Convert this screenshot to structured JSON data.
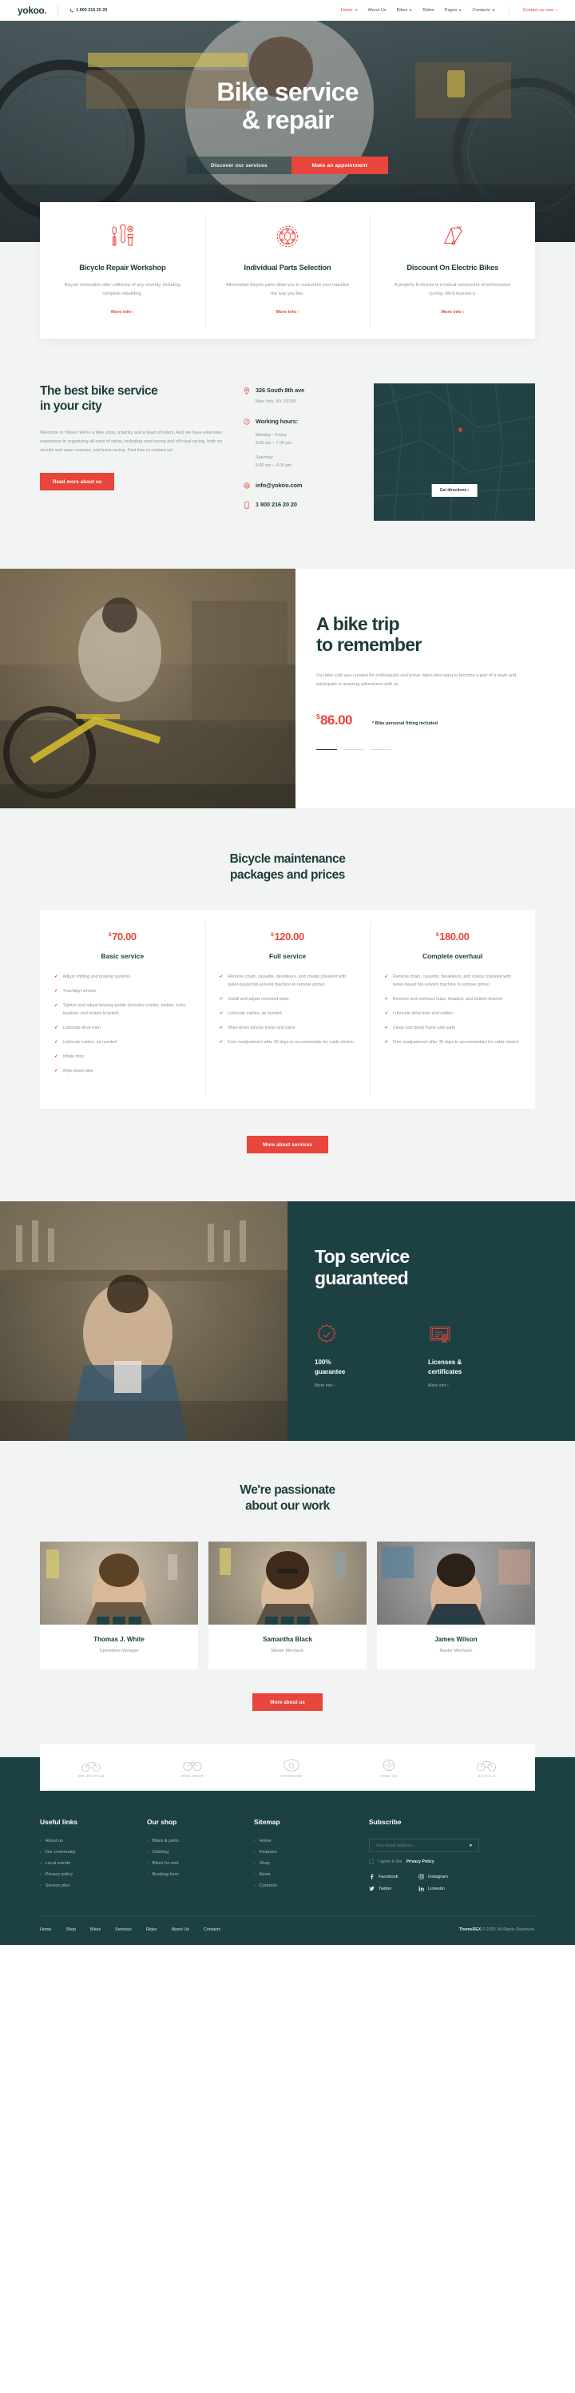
{
  "header": {
    "logo": "yokoo",
    "logo_dot": ".",
    "phone": "1 800 216 20 20",
    "nav": [
      {
        "label": "Home",
        "caret": true,
        "active": true
      },
      {
        "label": "About Us",
        "caret": false,
        "active": false
      },
      {
        "label": "Bikes",
        "caret": true,
        "active": false
      },
      {
        "label": "Rides",
        "caret": false,
        "active": false
      },
      {
        "label": "Pages",
        "caret": true,
        "active": false
      },
      {
        "label": "Contacts",
        "caret": true,
        "active": false
      }
    ],
    "cta": "Contact us now"
  },
  "hero": {
    "title_line1": "Bike service",
    "title_line2": "& repair",
    "btn_ghost": "Discover our services",
    "btn_primary": "Make an appointment"
  },
  "features": [
    {
      "icon": "tools-icon",
      "title": "Bicycle Repair Workshop",
      "desc": "Bicycle restoration after collisions of any severity, including complete rebuilding.",
      "link": "More info"
    },
    {
      "icon": "chainring-icon",
      "title": "Individual Parts Selection",
      "desc": "Aftermarket bicycle parts allow you to customize your machine the way you like.",
      "link": "More info"
    },
    {
      "icon": "bike-frame-icon",
      "title": "Discount On Electric Bikes",
      "desc": "A properly fit bicycle is a critical component of performance cycling. We'll improve it.",
      "link": "More info"
    }
  ],
  "about": {
    "title_line1": "The best bike service",
    "title_line2": "in your city",
    "text": "Welcome to Yokoo! We're a bike shop, a family and a team of riders. And we have extensive experience in organizing all sorts of races, including road racing and off-road racing, both on circuits and open courses, and track racing. Feel free to contact us!",
    "button": "Read more about us",
    "address_title": "326 South 8th ave",
    "address_sub": "New York. NY, 02158",
    "hours_title": "Working hours:",
    "hours_weekdays_label": "Monday - Friday",
    "hours_weekdays_value": "9.00 am – 7.00 pm",
    "hours_saturday_label": "Saturday",
    "hours_saturday_value": "9.00 am – 4.00 pm",
    "email": "info@yokoo.com",
    "phone": "1 800 216 20 20",
    "map_button": "Get directions"
  },
  "trip": {
    "title_line1": "A bike trip",
    "title_line2": "to remember",
    "text": "Our bike club was created for enthusiastic and brave riders who want to become a part of a team and participate in amazing adventures with us.",
    "currency": "$",
    "price": "86.00",
    "note": "* Bike personal fitting included"
  },
  "pricing": {
    "title_line1": "Bicycle maintenance",
    "title_line2": "packages and prices",
    "currency": "$",
    "button": "More about services",
    "plans": [
      {
        "price": "70.00",
        "name": "Basic service",
        "items": [
          "Adjust shifting and braking systems",
          "True/align wheels",
          "Tighten and adjust bearing points (includes cranks, pedals, hubs, headset, and bottom bracket)",
          "Lubricate drive train",
          "Lubricate cables, as needed",
          "Inflate tires",
          "Wipe-down bike"
        ]
      },
      {
        "price": "120.00",
        "name": "Full service",
        "items": [
          "Remove chain, cassette, derailleurs, and cranks (cleaned with water-based bio-solvent machine to remove grime)",
          "Install and adjust removed parts",
          "Lubricate cables, as needed",
          "Wipe-down bicycle frame and parts",
          "Free readjustment after 30 days to accommodate for cable stretch"
        ]
      },
      {
        "price": "180.00",
        "name": "Complete overhaul",
        "items": [
          "Remove chain, cassette, derailleurs, and cranks (cleaned with water-based bio-solvent machine to remove grime)",
          "Remove and overhaul hubs, headset, and bottom bracket",
          "Lubricate drive train and cables",
          "Clean and detail frame and parts",
          "Free readjustment after 30 days to accommodate for cable stretch"
        ]
      }
    ]
  },
  "top_service": {
    "title_line1": "Top service",
    "title_line2": "guaranteed",
    "cards": [
      {
        "icon": "badge-check-icon",
        "title_line1": "100%",
        "title_line2": "guarantee",
        "link": "More info"
      },
      {
        "icon": "certificate-icon",
        "title_line1": "Licenses &",
        "title_line2": "certificates",
        "link": "More info"
      }
    ]
  },
  "team": {
    "title_line1": "We're passionate",
    "title_line2": "about our work",
    "button": "More about us",
    "members": [
      {
        "name": "Thomas J. White",
        "role": "Operations Manager"
      },
      {
        "name": "Samantha Black",
        "role": "Master Mechanic"
      },
      {
        "name": "James Wilson",
        "role": "Master Mechanic"
      }
    ]
  },
  "brands": [
    {
      "label": "MR. BICYCLE"
    },
    {
      "label": "BIKE SHOP"
    },
    {
      "label": "STANDARD"
    },
    {
      "label": "RIDE ON"
    },
    {
      "label": "BICYCLE"
    }
  ],
  "footer": {
    "col1_title": "Useful links",
    "col1_items": [
      "About us",
      "Our community",
      "Local events",
      "Privacy policy",
      "Service plus"
    ],
    "col2_title": "Our shop",
    "col2_items": [
      "Bikes & parts",
      "Clothing",
      "Bikes for rent",
      "Booking form"
    ],
    "col3_title": "Sitemap",
    "col3_items": [
      "Home",
      "Features",
      "Shop",
      "News",
      "Contacts"
    ],
    "col4_title": "Subscribe",
    "email_placeholder": "Your email address...",
    "agree_text": "I agree to the",
    "agree_link": "Privacy Policy",
    "agree_tail": ".",
    "socials": [
      {
        "icon": "facebook-icon",
        "label": "Facebook"
      },
      {
        "icon": "instagram-icon",
        "label": "Instagram"
      },
      {
        "icon": "twitter-icon",
        "label": "Twitter"
      },
      {
        "icon": "linkedin-icon",
        "label": "Linkedin"
      }
    ],
    "bottom_nav": [
      "Home",
      "Shop",
      "Bikes",
      "Services",
      "Rides",
      "About Us",
      "Contacts"
    ],
    "copyright_brand": "ThemeREX",
    "copyright_rest": " © 2020. All Rights Reserved."
  },
  "colors": {
    "accent": "#e8453c",
    "dark": "#1d4043",
    "heading": "#1d3b3b",
    "muted": "#8b9696",
    "bg": "#f2f3f3"
  }
}
